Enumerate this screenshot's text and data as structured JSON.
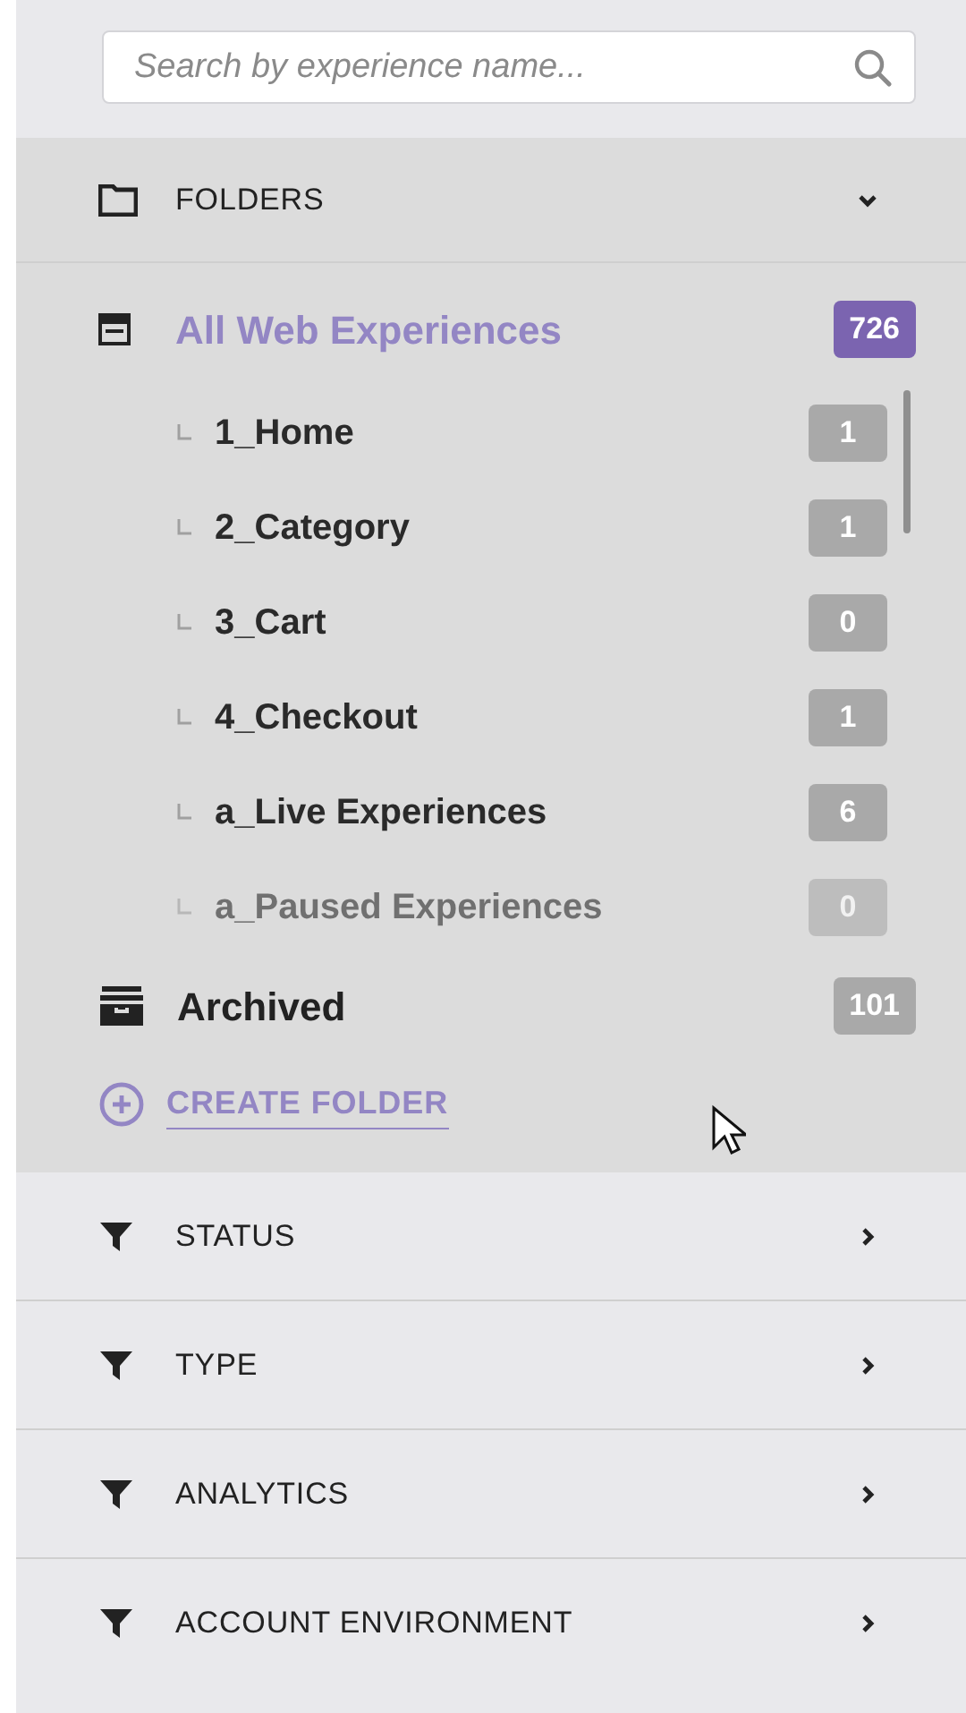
{
  "search": {
    "placeholder": "Search by experience name..."
  },
  "folders": {
    "label": "FOLDERS",
    "expanded": true,
    "all": {
      "label": "All Web Experiences",
      "count": "726",
      "selected": true
    },
    "children": [
      {
        "label": "1_Home",
        "count": "1",
        "faded": false
      },
      {
        "label": "2_Category",
        "count": "1",
        "faded": false
      },
      {
        "label": "3_Cart",
        "count": "0",
        "faded": false
      },
      {
        "label": "4_Checkout",
        "count": "1",
        "faded": false
      },
      {
        "label": "a_Live Experiences",
        "count": "6",
        "faded": false
      },
      {
        "label": "a_Paused Experiences",
        "count": "0",
        "faded": true
      }
    ],
    "archived": {
      "label": "Archived",
      "count": "101",
      "selected": false
    },
    "create": "CREATE FOLDER"
  },
  "filters": [
    {
      "label": "STATUS",
      "expanded": false
    },
    {
      "label": "TYPE",
      "expanded": false
    },
    {
      "label": "ANALYTICS",
      "expanded": false
    },
    {
      "label": "ACCOUNT ENVIRONMENT",
      "expanded": false
    }
  ]
}
